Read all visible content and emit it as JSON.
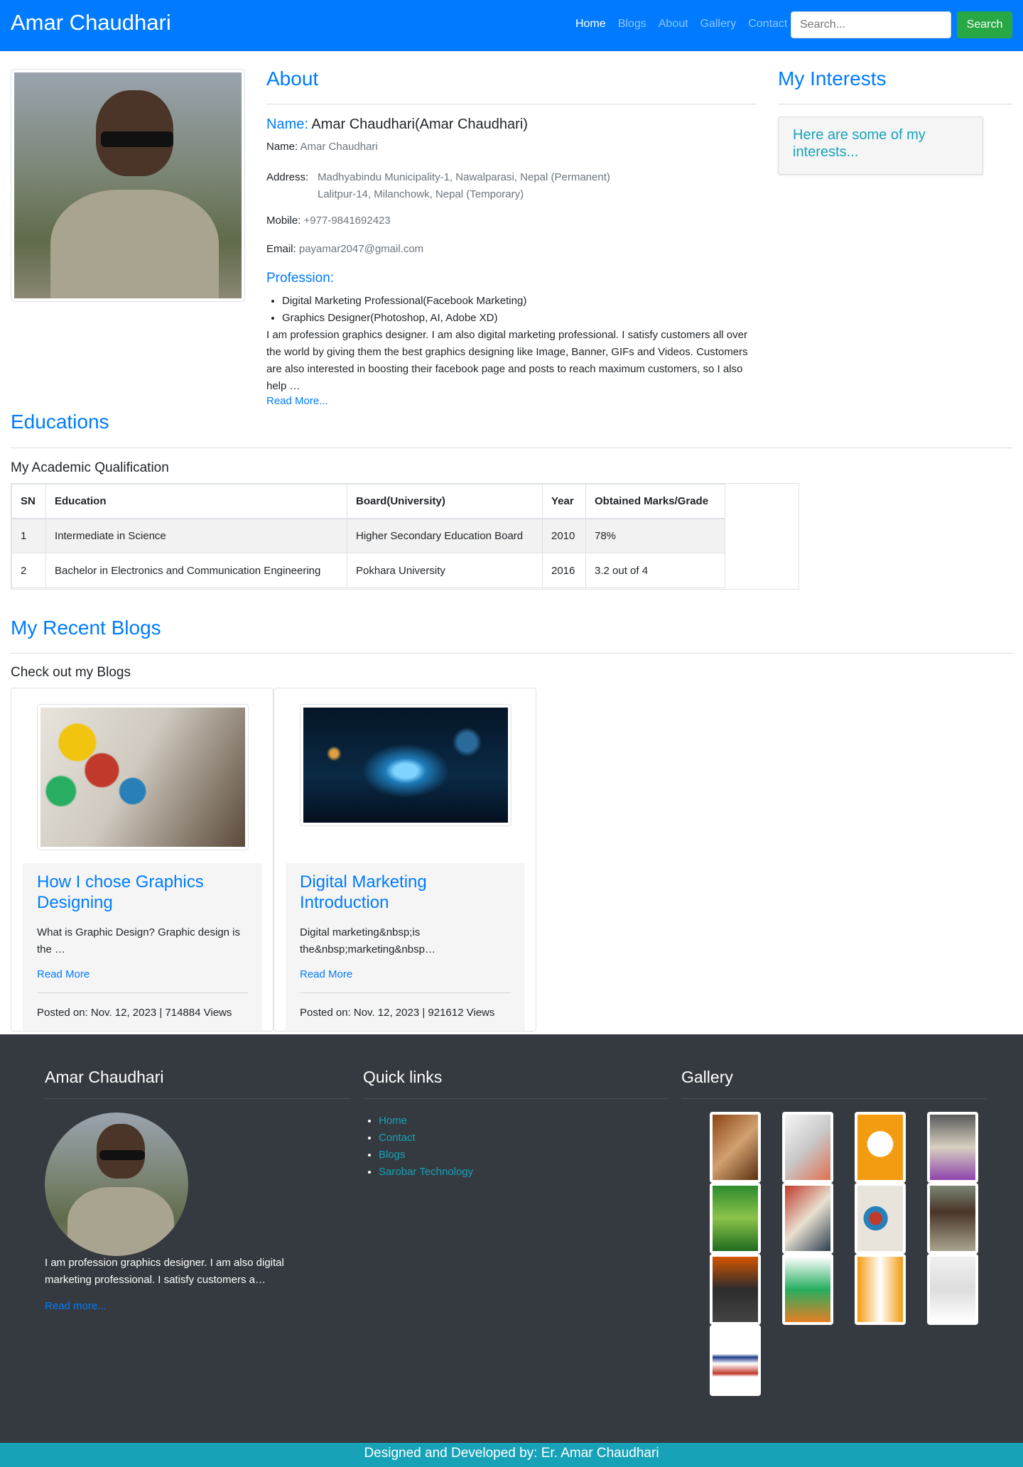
{
  "nav": {
    "brand": "Amar Chaudhari",
    "links": [
      "Home",
      "Blogs",
      "About",
      "Gallery",
      "Contact"
    ],
    "search_placeholder": "Search...",
    "search_button": "Search"
  },
  "about": {
    "title": "About",
    "name_label": "Name:",
    "name_value": "Amar Chaudhari(Amar Chaudhari)",
    "name_field_label": "Name:",
    "name_field_value": "Amar Chaudhari",
    "address_label": "Address:",
    "address_permanent": "Madhyabindu Municipality-1, Nawalparasi, Nepal (Permanent)",
    "address_temporary": "Lalitpur-14, Milanchowk, Nepal (Temporary)",
    "mobile_label": "Mobile:",
    "mobile_value": "+977-9841692423",
    "email_label": "Email:",
    "email_value": "payamar2047@gmail.com",
    "profession_title": "Profession:",
    "professions": [
      "Digital Marketing Professional(Facebook Marketing)",
      "Graphics Designer(Photoshop, AI, Adobe XD)"
    ],
    "description": "I am profession graphics designer. I am also digital marketing professional. I satisfy customers all over the world by giving them the best graphics designing like Image, Banner, GIFs and Videos. Customers are also interested in boosting their facebook page and posts to reach maximum customers, so I also help …",
    "read_more": "Read More..."
  },
  "interests": {
    "title": "My Interests",
    "text": "Here are some of my interests..."
  },
  "educations": {
    "title": "Educations",
    "subtitle": "My Academic Qualification",
    "headers": [
      "SN",
      "Education",
      "Board(University)",
      "Year",
      "Obtained Marks/Grade"
    ],
    "rows": [
      [
        "1",
        "Intermediate in Science",
        "Higher Secondary Education Board",
        "2010",
        "78%"
      ],
      [
        "2",
        "Bachelor in Electronics and Communication Engineering",
        "Pokhara University",
        "2016",
        "3.2 out of 4"
      ]
    ]
  },
  "blogs": {
    "title": "My Recent Blogs",
    "subtitle": "Check out my Blogs",
    "items": [
      {
        "title": "How I chose Graphics Designing",
        "excerpt": "What is Graphic Design? Graphic design is the …",
        "read_more": "Read More",
        "meta": "Posted on: Nov. 12, 2023 | 714884 Views"
      },
      {
        "title": "Digital Marketing Introduction",
        "excerpt": "Digital marketing&nbsp;is the&nbsp;marketing&nbsp…",
        "read_more": "Read More",
        "meta": "Posted on: Nov. 12, 2023 | 921612 Views"
      }
    ]
  },
  "footer": {
    "name_title": "Amar Chaudhari",
    "about": "I am profession graphics designer. I am also digital marketing professional. I satisfy customers a…",
    "read_more": "Read more...",
    "links_title": "Quick links",
    "links": [
      "Home",
      "Contact",
      "Blogs",
      "Sarobar Technology"
    ],
    "gallery_title": "Gallery",
    "credit": "Designed and Developed by: Er. Amar Chaudhari"
  },
  "colors": {
    "primary": "#007bff",
    "success": "#28a745",
    "info": "#17a2b8",
    "dark": "#343a40"
  }
}
